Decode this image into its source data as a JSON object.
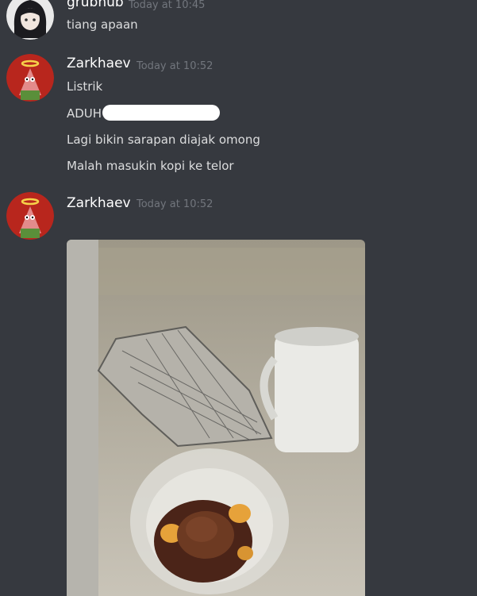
{
  "messages": [
    {
      "author": "grubhub",
      "timestamp": "Today at 10:45",
      "lines": [
        "tiang apaan"
      ]
    },
    {
      "author": "Zarkhaev",
      "timestamp": "Today at 10:52",
      "lines": [
        "Listrik",
        "ADUH",
        "Lagi bikin sarapan diajak omong",
        "Malah masukin kopi ke telor"
      ]
    },
    {
      "author": "Zarkhaev",
      "timestamp": "Today at 10:52",
      "lines": []
    }
  ],
  "colors": {
    "background": "#36393f",
    "username": "#ffffff",
    "timestamp": "#72767d",
    "text": "#dcddde"
  },
  "icons": {
    "avatar_1": "anime-girl-avatar",
    "avatar_2": "patrick-halo-avatar",
    "redaction": "white-scribble"
  }
}
